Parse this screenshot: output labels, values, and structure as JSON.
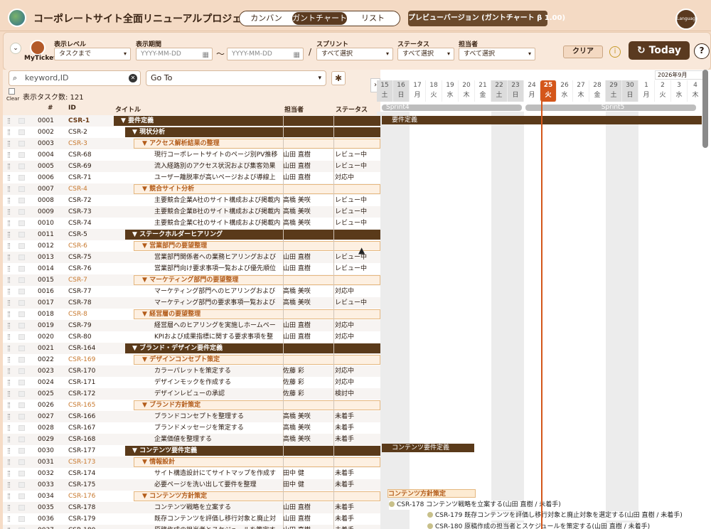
{
  "app": {
    "title": "コーポレートサイト全面リニューアルプロジェクト",
    "preview_label": "プレビューバージョン (ガントチャート β 1.00)",
    "language_label": "Language"
  },
  "view_tabs": [
    {
      "label": "カンバン",
      "active": false
    },
    {
      "label": "ガントチャート",
      "active": true
    },
    {
      "label": "リスト",
      "active": false
    }
  ],
  "filters": {
    "my_ticket": "MyTicket",
    "display_level": {
      "label": "表示レベル",
      "value": "タスクまで"
    },
    "period": {
      "label": "表示期間",
      "start_placeholder": "YYYY-MM-DD",
      "end_placeholder": "YYYY-MM-DD",
      "separator": "〜"
    },
    "sprint": {
      "label": "スプリント",
      "value": "すべて選択"
    },
    "status": {
      "label": "ステータス",
      "value": "すべて選択"
    },
    "assignee": {
      "label": "担当者",
      "value": "すべて選択"
    },
    "clear_label": "クリア",
    "today_label": "Today",
    "slash": "/"
  },
  "search": {
    "placeholder": "keyword,ID",
    "goto_label": "Go To",
    "clear_label": "Clear",
    "task_count": "表示タスク数: 121"
  },
  "columns": {
    "num": "#",
    "id": "ID",
    "title": "タイトル",
    "assignee": "担当者",
    "status": "ステータス"
  },
  "rows": [
    {
      "num": "0001",
      "id": "CSR-1",
      "title": "要件定義",
      "assignee": "",
      "status": "",
      "level": 0
    },
    {
      "num": "0002",
      "id": "CSR-2",
      "title": "現状分析",
      "assignee": "",
      "status": "",
      "level": 1
    },
    {
      "num": "0003",
      "id": "CSR-3",
      "title": "アクセス解析結果の整理",
      "assignee": "",
      "status": "",
      "level": 2
    },
    {
      "num": "0004",
      "id": "CSR-68",
      "title": "現行コーポレートサイトのページ別PV推移",
      "assignee": "山田 直樹",
      "status": "レビュー中",
      "level": 3
    },
    {
      "num": "0005",
      "id": "CSR-69",
      "title": "流入経路別のアクセス状況および集客効果",
      "assignee": "山田 直樹",
      "status": "レビュー中",
      "level": 3
    },
    {
      "num": "0006",
      "id": "CSR-71",
      "title": "ユーザー離脱率が高いページおよび導線上",
      "assignee": "山田 直樹",
      "status": "対応中",
      "level": 3
    },
    {
      "num": "0007",
      "id": "CSR-4",
      "title": "競合サイト分析",
      "assignee": "",
      "status": "",
      "level": 2
    },
    {
      "num": "0008",
      "id": "CSR-72",
      "title": "主要競合企業A社のサイト構成および掲載内",
      "assignee": "高橋 美咲",
      "status": "レビュー中",
      "level": 3
    },
    {
      "num": "0009",
      "id": "CSR-73",
      "title": "主要競合企業B社のサイト構成および掲載内",
      "assignee": "高橋 美咲",
      "status": "レビュー中",
      "level": 3
    },
    {
      "num": "0010",
      "id": "CSR-74",
      "title": "主要競合企業C社のサイト構成および掲載内",
      "assignee": "高橋 美咲",
      "status": "レビュー中",
      "level": 3
    },
    {
      "num": "0011",
      "id": "CSR-5",
      "title": "ステークホルダーヒアリング",
      "assignee": "",
      "status": "",
      "level": 1
    },
    {
      "num": "0012",
      "id": "CSR-6",
      "title": "営業部門の要望整理",
      "assignee": "",
      "status": "",
      "level": 2
    },
    {
      "num": "0013",
      "id": "CSR-75",
      "title": "営業部門関係者への業務ヒアリングおよび",
      "assignee": "山田 直樹",
      "status": "レビュー中",
      "level": 3
    },
    {
      "num": "0014",
      "id": "CSR-76",
      "title": "営業部門向け要求事項一覧および優先順位",
      "assignee": "山田 直樹",
      "status": "レビュー中",
      "level": 3
    },
    {
      "num": "0015",
      "id": "CSR-7",
      "title": "マーケティング部門の要望整理",
      "assignee": "",
      "status": "",
      "level": 2
    },
    {
      "num": "0016",
      "id": "CSR-77",
      "title": "マーケティング部門へのヒアリングおよび",
      "assignee": "高橋 美咲",
      "status": "対応中",
      "level": 3
    },
    {
      "num": "0017",
      "id": "CSR-78",
      "title": "マーケティング部門の要求事項一覧および",
      "assignee": "高橋 美咲",
      "status": "レビュー中",
      "level": 3
    },
    {
      "num": "0018",
      "id": "CSR-8",
      "title": "経営層の要望整理",
      "assignee": "",
      "status": "",
      "level": 2
    },
    {
      "num": "0019",
      "id": "CSR-79",
      "title": "経営層へのヒアリングを実施しホームペー",
      "assignee": "山田 直樹",
      "status": "対応中",
      "level": 3
    },
    {
      "num": "0020",
      "id": "CSR-80",
      "title": "KPIおよび成果指標に関する要求事項を整",
      "assignee": "山田 直樹",
      "status": "対応中",
      "level": 3
    },
    {
      "num": "0021",
      "id": "CSR-164",
      "title": "ブランド・デザイン要件定義",
      "assignee": "",
      "status": "",
      "level": 1
    },
    {
      "num": "0022",
      "id": "CSR-169",
      "title": "デザインコンセプト策定",
      "assignee": "",
      "status": "",
      "level": 2
    },
    {
      "num": "0023",
      "id": "CSR-170",
      "title": "カラーパレットを策定する",
      "assignee": "佐藤 彩",
      "status": "対応中",
      "level": 3
    },
    {
      "num": "0024",
      "id": "CSR-171",
      "title": "デザインモックを作成する",
      "assignee": "佐藤 彩",
      "status": "対応中",
      "level": 3
    },
    {
      "num": "0025",
      "id": "CSR-172",
      "title": "デザインレビューの承認",
      "assignee": "佐藤 彩",
      "status": "検討中",
      "level": 3
    },
    {
      "num": "0026",
      "id": "CSR-165",
      "title": "ブランド方針策定",
      "assignee": "",
      "status": "",
      "level": 2
    },
    {
      "num": "0027",
      "id": "CSR-166",
      "title": "ブランドコンセプトを整理する",
      "assignee": "高橋 美咲",
      "status": "未着手",
      "level": 3
    },
    {
      "num": "0028",
      "id": "CSR-167",
      "title": "ブランドメッセージを策定する",
      "assignee": "高橋 美咲",
      "status": "未着手",
      "level": 3
    },
    {
      "num": "0029",
      "id": "CSR-168",
      "title": "企業価値を整理する",
      "assignee": "高橋 美咲",
      "status": "未着手",
      "level": 3
    },
    {
      "num": "0030",
      "id": "CSR-177",
      "title": "コンテンツ要件定義",
      "assignee": "",
      "status": "",
      "level": 1
    },
    {
      "num": "0031",
      "id": "CSR-173",
      "title": "情報設計",
      "assignee": "",
      "status": "",
      "level": 2
    },
    {
      "num": "0032",
      "id": "CSR-174",
      "title": "サイト構造設計にてサイトマップを作成す",
      "assignee": "田中 健",
      "status": "未着手",
      "level": 3
    },
    {
      "num": "0033",
      "id": "CSR-175",
      "title": "必要ページを洗い出して要件を整理",
      "assignee": "田中 健",
      "status": "未着手",
      "level": 3
    },
    {
      "num": "0034",
      "id": "CSR-176",
      "title": "コンテンツ方針策定",
      "assignee": "",
      "status": "",
      "level": 2
    },
    {
      "num": "0035",
      "id": "CSR-178",
      "title": "コンテンツ戦略を立案する",
      "assignee": "山田 直樹",
      "status": "未着手",
      "level": 3
    },
    {
      "num": "0036",
      "id": "CSR-179",
      "title": "既存コンテンツを評価し移行対象と廃止対",
      "assignee": "山田 直樹",
      "status": "未着手",
      "level": 3
    },
    {
      "num": "0037",
      "id": "CSR-180",
      "title": "原稿作成の担当者とスケジュールを策定す",
      "assignee": "山田 直樹",
      "status": "未着手",
      "level": 3
    }
  ],
  "gantt": {
    "month_label": "2026年9月",
    "days": [
      {
        "d": "15",
        "w": "土",
        "weekend": true
      },
      {
        "d": "16",
        "w": "日",
        "weekend": true
      },
      {
        "d": "17",
        "w": "月"
      },
      {
        "d": "18",
        "w": "火"
      },
      {
        "d": "19",
        "w": "水"
      },
      {
        "d": "20",
        "w": "木"
      },
      {
        "d": "21",
        "w": "金"
      },
      {
        "d": "22",
        "w": "土",
        "weekend": true
      },
      {
        "d": "23",
        "w": "日",
        "weekend": true
      },
      {
        "d": "24",
        "w": "月"
      },
      {
        "d": "25",
        "w": "火",
        "today": true
      },
      {
        "d": "26",
        "w": "水"
      },
      {
        "d": "27",
        "w": "木"
      },
      {
        "d": "28",
        "w": "金"
      },
      {
        "d": "29",
        "w": "土",
        "weekend": true
      },
      {
        "d": "30",
        "w": "日",
        "weekend": true
      },
      {
        "d": "1",
        "w": "月"
      },
      {
        "d": "2",
        "w": "火"
      },
      {
        "d": "3",
        "w": "水"
      },
      {
        "d": "4",
        "w": "木"
      }
    ],
    "sprints": [
      {
        "name": "Sprint4"
      },
      {
        "name": "Sprint5"
      }
    ],
    "bars": {
      "req": "要件定義",
      "content_req": "コンテンツ要件定義",
      "content_policy": "コンテンツ方針策定",
      "t178": "CSR-178 コンテンツ戦略を立案する(山田 直樹 / 未着手)",
      "t179": "CSR-179 既存コンテンツを評価し移行対象と廃止対象を選定する(山田 直樹 / 未着手)",
      "t180": "CSR-180 原稿作成の担当者とスケジュールを策定する(山田 直樹 / 未着手)"
    }
  }
}
